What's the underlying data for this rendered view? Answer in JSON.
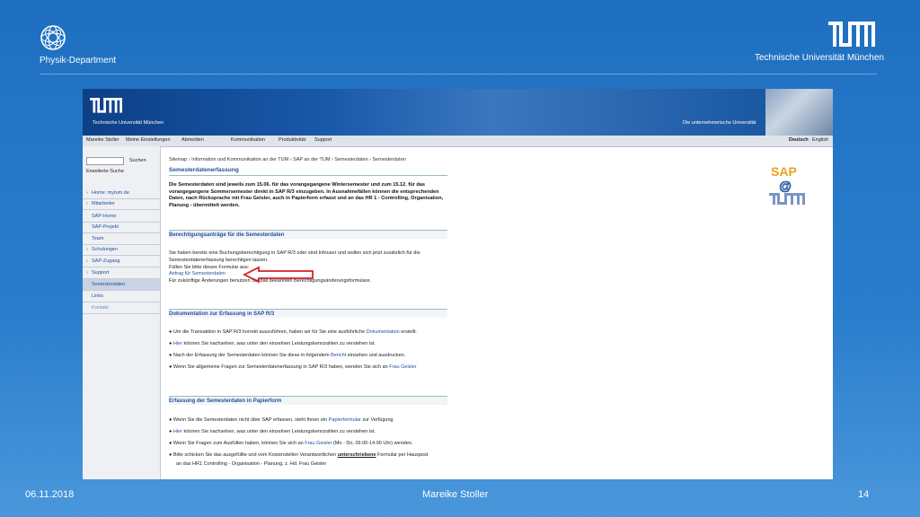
{
  "slide": {
    "department": "Physik-Department",
    "university": "Technische Universität München",
    "footer_date": "06.11.2018",
    "footer_author": "Mareike Stoller",
    "page_number": "14"
  },
  "portal": {
    "header_university": "Technische Universität München",
    "header_claim": "Die unternehmerische Universität",
    "topnav": {
      "user": "Mareike Stoller",
      "settings": "Meine Einstellungen",
      "logout": "Abmelden",
      "communication": "Kommunikation",
      "productivity": "Produktivität",
      "support": "Support",
      "lang_de": "Deutsch",
      "lang_en": "English"
    },
    "sidebar": {
      "search_label": "Suchen",
      "advanced_search": "Erweiterte Suche",
      "items": [
        {
          "label": "Home: mytum.de"
        },
        {
          "label": "Mitarbeiter"
        },
        {
          "label": "SAP-Home"
        },
        {
          "label": "SAP-Projekt"
        },
        {
          "label": "Team"
        },
        {
          "label": "Schulungen"
        },
        {
          "label": "SAP-Zugang"
        },
        {
          "label": "Support"
        },
        {
          "label": "Semesterdaten"
        },
        {
          "label": "Links"
        },
        {
          "label": "Kontakt"
        }
      ]
    },
    "breadcrumb": "Sitemap › Information und Kommunikation an der TUM › SAP an der TUM › Semesterdaten › Semesterdaten",
    "main_heading": "Semesterdatenerfassung",
    "intro": "Die Semesterdaten sind jeweils zum 15.06. für das vorangegangene Wintersemester und zum 15.12. für das vorangegangene Sommersemester direkt in SAP R/3 einzugeben. In Ausnahmefällen können die entsprechenden Daten, nach Rücksprache mit Frau Geisler, auch in Papierform erfasst und an das HR 1 - Controlling, Organisation, Planung - übermittelt werden.",
    "section1": {
      "heading": "Berechtigungsanträge für die Semesterdaten",
      "text1": "Sie haben bereits eine Buchungsberechtigung in SAP R/3 oder sind Infouser und wollen sich jetzt zusätzlich für die Semesterdatenerfassung berechtigen lassen.",
      "text2": "Füllen Sie bitte dieses Formular aus:",
      "link": "Antrag für Semesterdaten",
      "text3": "Für zukünftige Änderungen benutzen Sie das bekannten Berechtigungsänderungsformulare."
    },
    "section2": {
      "heading": "Dokumentation zur Erfassung in SAP R/3",
      "b1_pre": "Um die Transaktion in SAP R/3 korrekt auszuführen, haben wir für Sie eine ausführliche ",
      "b1_link": "Dokumentation",
      "b1_post": " erstellt.",
      "b2_link": "Hier",
      "b2_post": " können Sie nachsehen, was unter den einzelnen Leistungskennzahlen zu verstehen ist.",
      "b3_pre": "Nach der Erfassung der Semesterdaten können Sie diese in folgendem ",
      "b3_link": "Bericht",
      "b3_post": " einsehen und ausdrucken.",
      "b4_pre": "Wenn Sie allgemeine Fragen zur Semesterdatenerfassung in SAP R/3 haben, wenden Sie sich an ",
      "b4_link": "Frau Geisler"
    },
    "section3": {
      "heading": "Erfassung der Semesterdaten in Papierform",
      "b1_pre": "Wenn Sie die Semesterdaten nicht über SAP erfassen, steht Ihnen ein ",
      "b1_link": "Papierformular",
      "b1_post": " zur Verfügung",
      "b2_link": "Hier",
      "b2_post": " können Sie nachsehen, was unter den einzelnen Leistungskennzahlen zu verstehen ist.",
      "b3_pre": "Wenn Sie Fragen zum Ausfüllen haben, können Sie sich an ",
      "b3_link": "Frau Geisler",
      "b3_post": " (Mo - Do, 09.00-14.00 Uhr) wenden.",
      "b4_pre": "Bitte schicken Sie das ausgefüllte und vom Kostenstellen Verantwortlichen ",
      "b4_bold": "unterschriebene",
      "b4_post": " Formular per Hauspost",
      "b4_line2": "an das HR1 Controlling - Organisation - Planung, z. Hd. Frau Geisler"
    },
    "sap_logo_text": "SAP",
    "colors": {
      "accent": "#1d4f9a",
      "slide_bg": "#2a7dcc",
      "arrow": "#d81f26"
    }
  }
}
